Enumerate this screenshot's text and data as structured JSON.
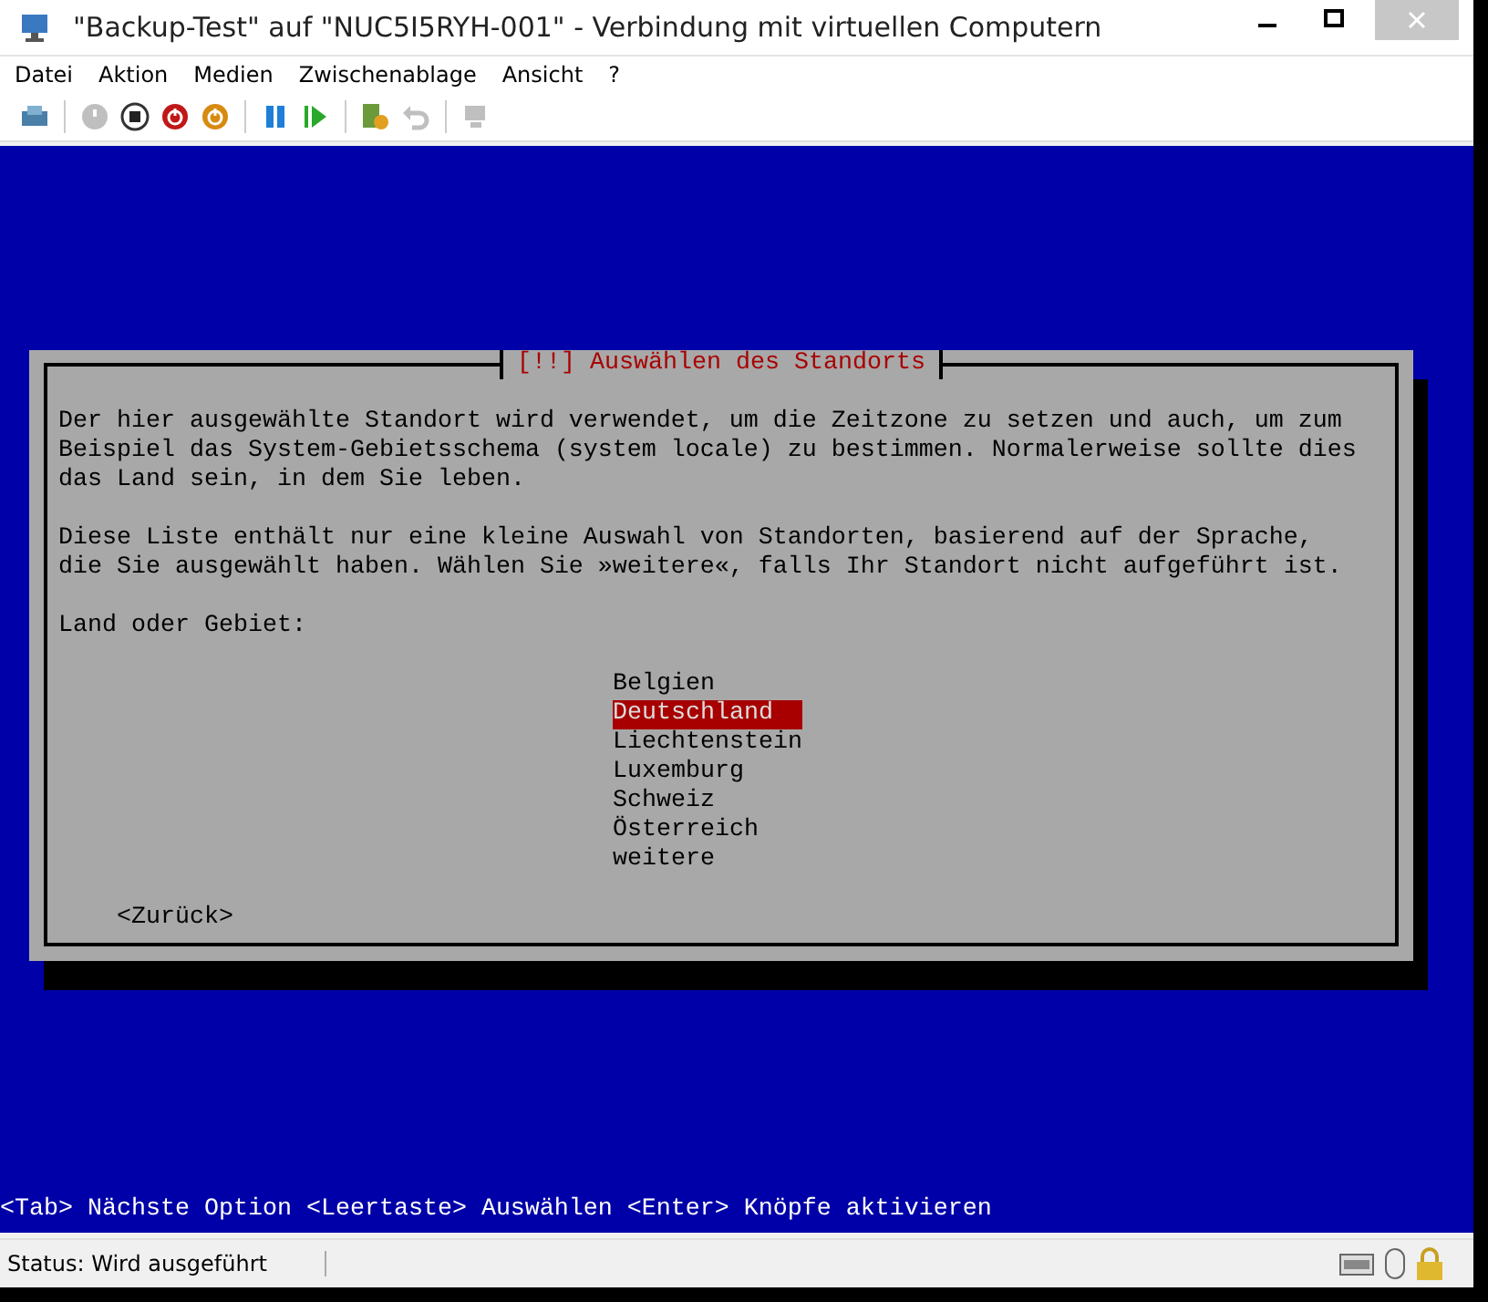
{
  "window": {
    "title": "\"Backup-Test\" auf \"NUC5I5RYH-001\" - Verbindung mit virtuellen Computern"
  },
  "menu": [
    "Datei",
    "Aktion",
    "Medien",
    "Zwischenablage",
    "Ansicht",
    "?"
  ],
  "toolbar": [
    {
      "kind": "ctrl-alt-del",
      "disabled": false
    },
    {
      "kind": "start",
      "disabled": true
    },
    {
      "kind": "turn-off",
      "disabled": false
    },
    {
      "kind": "shut-down",
      "disabled": false
    },
    {
      "kind": "save",
      "disabled": false
    },
    {
      "kind": "pause",
      "disabled": false
    },
    {
      "kind": "resume",
      "disabled": false
    },
    {
      "kind": "checkpoint",
      "disabled": false
    },
    {
      "kind": "revert",
      "disabled": true
    },
    {
      "kind": "session",
      "disabled": true
    }
  ],
  "dialog": {
    "title": "[!!] Auswählen des Standorts",
    "paragraphs": [
      [
        "Der hier ausgewählte Standort wird verwendet, um die Zeitzone zu setzen und auch, um zum",
        "Beispiel das System-Gebietsschema (system locale) zu bestimmen. Normalerweise sollte dies",
        "das Land sein, in dem Sie leben."
      ],
      [
        "Diese Liste enthält nur eine kleine Auswahl von Standorten, basierend auf der Sprache,",
        "die Sie ausgewählt haben. Wählen Sie »weitere«, falls Ihr Standort nicht aufgeführt ist."
      ]
    ],
    "prompt": "Land oder Gebiet:",
    "options": [
      {
        "label": "Belgien",
        "selected": false
      },
      {
        "label": "Deutschland",
        "selected": true
      },
      {
        "label": "Liechtenstein",
        "selected": false
      },
      {
        "label": "Luxemburg",
        "selected": false
      },
      {
        "label": "Schweiz",
        "selected": false
      },
      {
        "label": "Österreich",
        "selected": false
      },
      {
        "label": "weitere",
        "selected": false
      }
    ],
    "back_button": "<Zurück>"
  },
  "hint_line": "<Tab> Nächste Option <Leertaste> Auswählen <Enter> Knöpfe aktivieren",
  "status_bar": {
    "text": "Status: Wird ausgeführt"
  }
}
